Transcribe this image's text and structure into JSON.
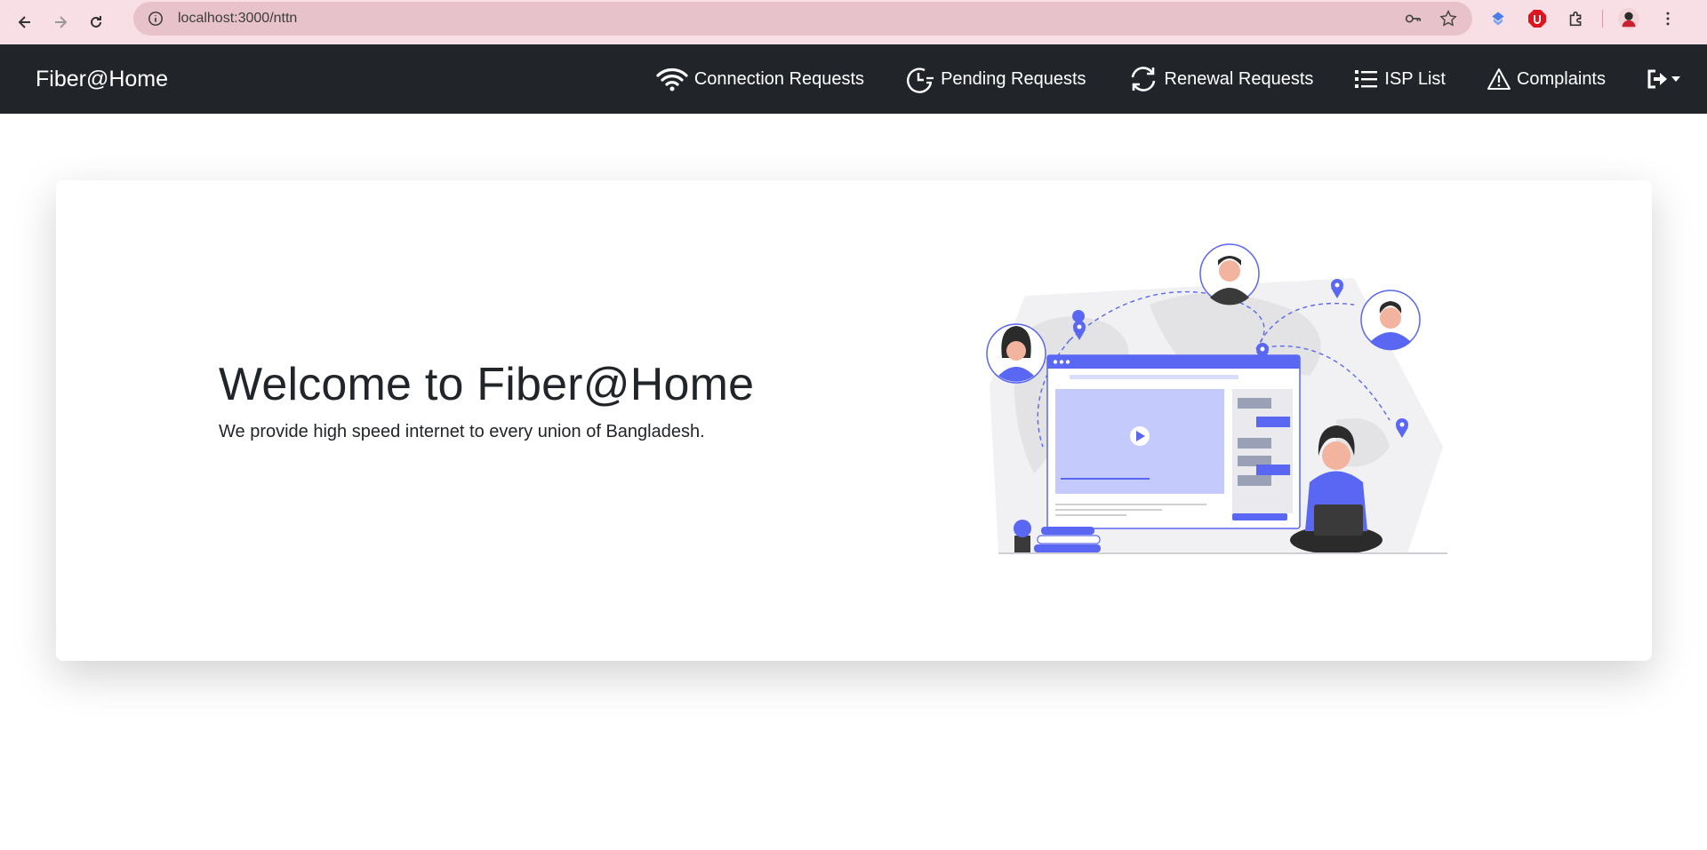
{
  "browser": {
    "url": "localhost:3000/nttn"
  },
  "navbar": {
    "brand": "Fiber@Home",
    "links": [
      {
        "label": "Connection Requests",
        "icon": "wifi-icon"
      },
      {
        "label": "Pending Requests",
        "icon": "clock-icon"
      },
      {
        "label": "Renewal Requests",
        "icon": "refresh-icon"
      },
      {
        "label": "ISP List",
        "icon": "list-icon"
      },
      {
        "label": "Complaints",
        "icon": "warning-icon"
      }
    ],
    "logout_icon": "logout-icon"
  },
  "hero": {
    "title": "Welcome to Fiber@Home",
    "subtitle": "We provide high speed internet to every union of Bangladesh."
  },
  "colors": {
    "navbar_bg": "#212529",
    "accent": "#5a67f2",
    "chrome_bg": "#f8dfe6"
  }
}
